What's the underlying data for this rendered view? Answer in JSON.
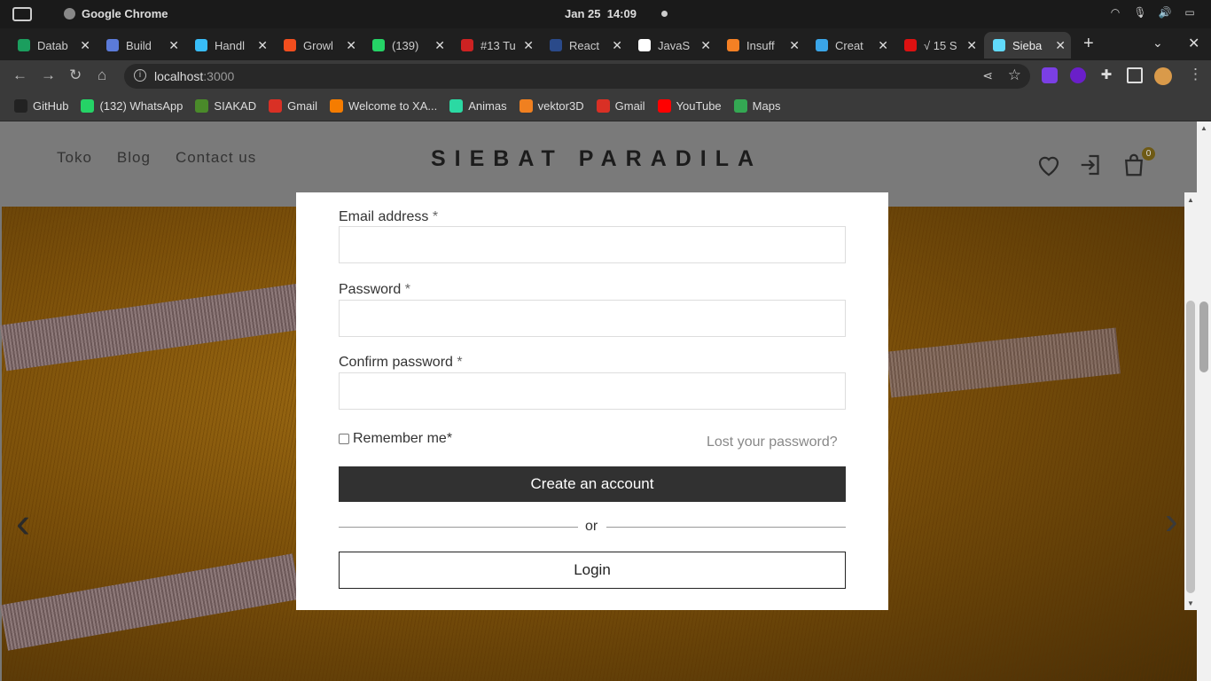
{
  "os_bar": {
    "app_name": "Google Chrome",
    "date": "Jan 25",
    "time": "14:09"
  },
  "browser": {
    "tabs": [
      {
        "label": "Datab",
        "color": "#1b9e5e"
      },
      {
        "label": "Build",
        "color": "#5b7bd9"
      },
      {
        "label": "Handl",
        "color": "#38bdf8"
      },
      {
        "label": "Growl",
        "color": "#f24e1e"
      },
      {
        "label": "(139)",
        "color": "#25d366"
      },
      {
        "label": "#13 Tu",
        "color": "#cc2222"
      },
      {
        "label": "React",
        "color": "#2a4a8a"
      },
      {
        "label": "JavaS",
        "color": "#ffffff"
      },
      {
        "label": "Insuff",
        "color": "#f48024"
      },
      {
        "label": "Creat",
        "color": "#3aa5e8"
      },
      {
        "label": "√ 15 S",
        "color": "#d11"
      },
      {
        "label": "Sieba",
        "color": "#61dafb"
      }
    ],
    "url_host": "localhost",
    "url_port": ":3000",
    "bookmarks": [
      {
        "label": "GitHub",
        "color": "#222"
      },
      {
        "label": "(132) WhatsApp",
        "color": "#25d366"
      },
      {
        "label": "SIAKAD",
        "color": "#4a8a2a"
      },
      {
        "label": "Gmail",
        "color": "#d93025"
      },
      {
        "label": "Welcome to XA...",
        "color": "#f57c00"
      },
      {
        "label": "Animas",
        "color": "#2bd9a3"
      },
      {
        "label": "vektor3D",
        "color": "#f08020"
      },
      {
        "label": "Gmail",
        "color": "#d93025"
      },
      {
        "label": "YouTube",
        "color": "#ff0000"
      },
      {
        "label": "Maps",
        "color": "#34a853"
      }
    ]
  },
  "site": {
    "nav": [
      "Toko",
      "Blog",
      "Contact us"
    ],
    "brand": "SIEBAT PARADILA",
    "cart_count": "0"
  },
  "form": {
    "email_label": "Email address",
    "password_label": "Password",
    "confirm_label": "Confirm password",
    "required_mark": "*",
    "remember_label": "Remember me",
    "lost_password": "Lost your password?",
    "create_button": "Create an account",
    "or_text": "or",
    "login_button": "Login"
  }
}
